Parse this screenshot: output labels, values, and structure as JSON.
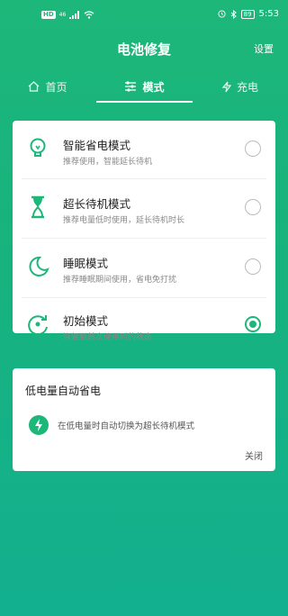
{
  "status": {
    "hd": "HD",
    "signal_label": "46",
    "battery": "89",
    "time": "5:53"
  },
  "header": {
    "title": "电池修复",
    "settings": "设置"
  },
  "tabs": [
    {
      "label": "首页",
      "icon": "home-icon"
    },
    {
      "label": "模式",
      "icon": "sliders-icon"
    },
    {
      "label": "充电",
      "icon": "bolt-icon"
    }
  ],
  "modes": [
    {
      "name": "智能省电模式",
      "desc": "推荐使用，智能延长待机",
      "icon": "bulb-icon",
      "selected": false
    },
    {
      "name": "超长待机模式",
      "desc": "推荐电量低时使用，延长待机时长",
      "icon": "hourglass-icon",
      "selected": false
    },
    {
      "name": "睡眠模式",
      "desc": "推荐睡眠期间使用，省电免打扰",
      "icon": "moon-icon",
      "selected": false
    },
    {
      "name": "初始模式",
      "desc": "恢复到首次使用时的状态",
      "icon": "reset-icon",
      "selected": true
    }
  ],
  "auto_save": {
    "title": "低电量自动省电",
    "text": "在低电量时自动切换为超长待机模式",
    "close": "关闭"
  },
  "colors": {
    "accent": "#1db77a"
  }
}
